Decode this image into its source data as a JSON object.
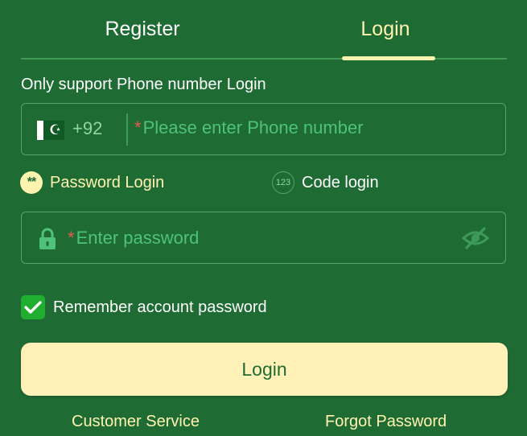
{
  "tabs": {
    "register": "Register",
    "login": "Login",
    "active": "login"
  },
  "hint": "Only support Phone number Login",
  "phone": {
    "flag_icon": "pakistan-flag-icon",
    "dial_code": "+92",
    "required_mark": "*",
    "placeholder": "Please enter Phone number",
    "value": ""
  },
  "login_options": {
    "password": {
      "icon_text": "**",
      "label": "Password Login",
      "selected": true
    },
    "code": {
      "icon_text": "123",
      "label": "Code login",
      "selected": false
    }
  },
  "password": {
    "icon": "lock-icon",
    "required_mark": "*",
    "placeholder": "Enter password",
    "value": "",
    "visibility_icon": "eye-off-icon"
  },
  "remember": {
    "label": "Remember account password",
    "checked": true
  },
  "login_button": "Login",
  "footer": {
    "customer_service": "Customer Service",
    "forgot_password": "Forgot Password"
  },
  "colors": {
    "background": "#1e6b34",
    "accent": "#fff3b0",
    "button_bg": "#fff1b8",
    "placeholder": "#4fc27a",
    "required": "#e55b4b",
    "checkbox": "#1fae2f"
  }
}
